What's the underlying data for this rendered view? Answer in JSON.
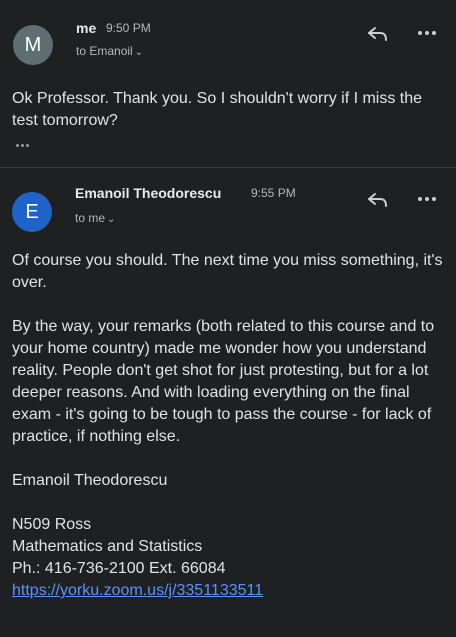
{
  "message1": {
    "avatar_letter": "M",
    "sender": "me",
    "time": "9:50 PM",
    "to": "to Emanoil",
    "body": "Ok Professor. Thank you. So I shouldn't worry if I miss the test tomorrow?",
    "avatar_color": "#5f6e73"
  },
  "message2": {
    "avatar_letter": "E",
    "sender": "Emanoil Theodorescu",
    "time": "9:55 PM",
    "to": "to me",
    "avatar_color": "#1d63c8",
    "paragraph1": "Of course you should. The next time you miss something, it's over.",
    "paragraph2": "By the way, your remarks (both related to this course and to your home country) made me wonder how you understand reality. People don't get shot for just protesting, but for a lot deeper reasons. And with loading everything on the final exam - it's going to be tough to pass the course - for lack of practice, if nothing else.",
    "signature_name": "Emanoil Theodorescu",
    "sig_line1": "N509 Ross",
    "sig_line2": "Mathematics and Statistics",
    "sig_line3": "Ph.: 416-736-2100 Ext. 66084",
    "sig_link": "https://yorku.zoom.us/j/3351133511"
  },
  "icons": {
    "reply": "reply-icon",
    "more": "more-options-icon",
    "chevron": "chevron-down-icon",
    "ellipsis": "show-trimmed-content-icon"
  },
  "colors": {
    "background": "#1f2022",
    "link": "#5a93ff"
  }
}
